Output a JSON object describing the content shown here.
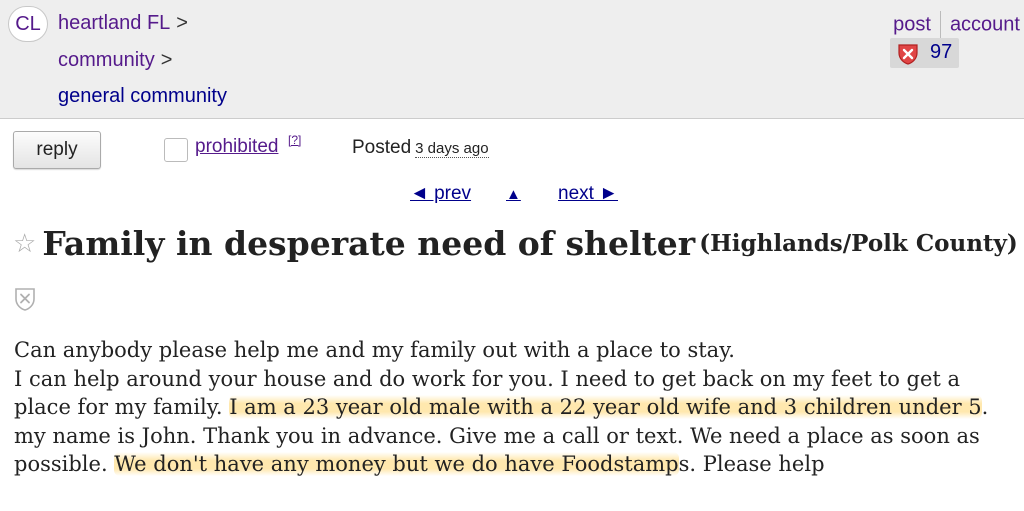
{
  "header": {
    "logo": "CL",
    "breadcrumbs": [
      {
        "label": "heartland FL",
        "sep": ">"
      },
      {
        "label": "community",
        "sep": ">"
      },
      {
        "label": "general community"
      }
    ],
    "post_link": "post",
    "account_link": "account",
    "badge_count": "97",
    "badge_icon": "shield-x-icon"
  },
  "toolbar": {
    "reply_label": "reply",
    "prohibited_label": "prohibited",
    "help_label": "[?]",
    "posted_label": "Posted",
    "posted_ago": "3 days ago"
  },
  "nav": {
    "prev": "◄ prev",
    "up": "▲",
    "next": "next ►"
  },
  "posting": {
    "star_icon": "star-icon",
    "title": "Family in desperate need of shelter",
    "location": "(Highlands/Polk County)",
    "body": {
      "p1": "Can anybody please help me and my family out with a place to stay.",
      "p2": "I can help around your house and do work for you. I need to get back on my feet to get a place for my family. ",
      "h1": "I am a 23 year old male with a 22 year old wife and 3 children under 5",
      "p3": ". my name is John. Thank you in advance. Give me a call or text. We need a place as soon as possible. ",
      "h2": "We don't have any money but we do have Foodstamp",
      "p4": "s. Please help"
    }
  },
  "colors": {
    "link_purple": "#551a8b",
    "link_blue": "#00008b",
    "header_bg": "#eeeeee",
    "highlight": "#ffe4a0"
  }
}
